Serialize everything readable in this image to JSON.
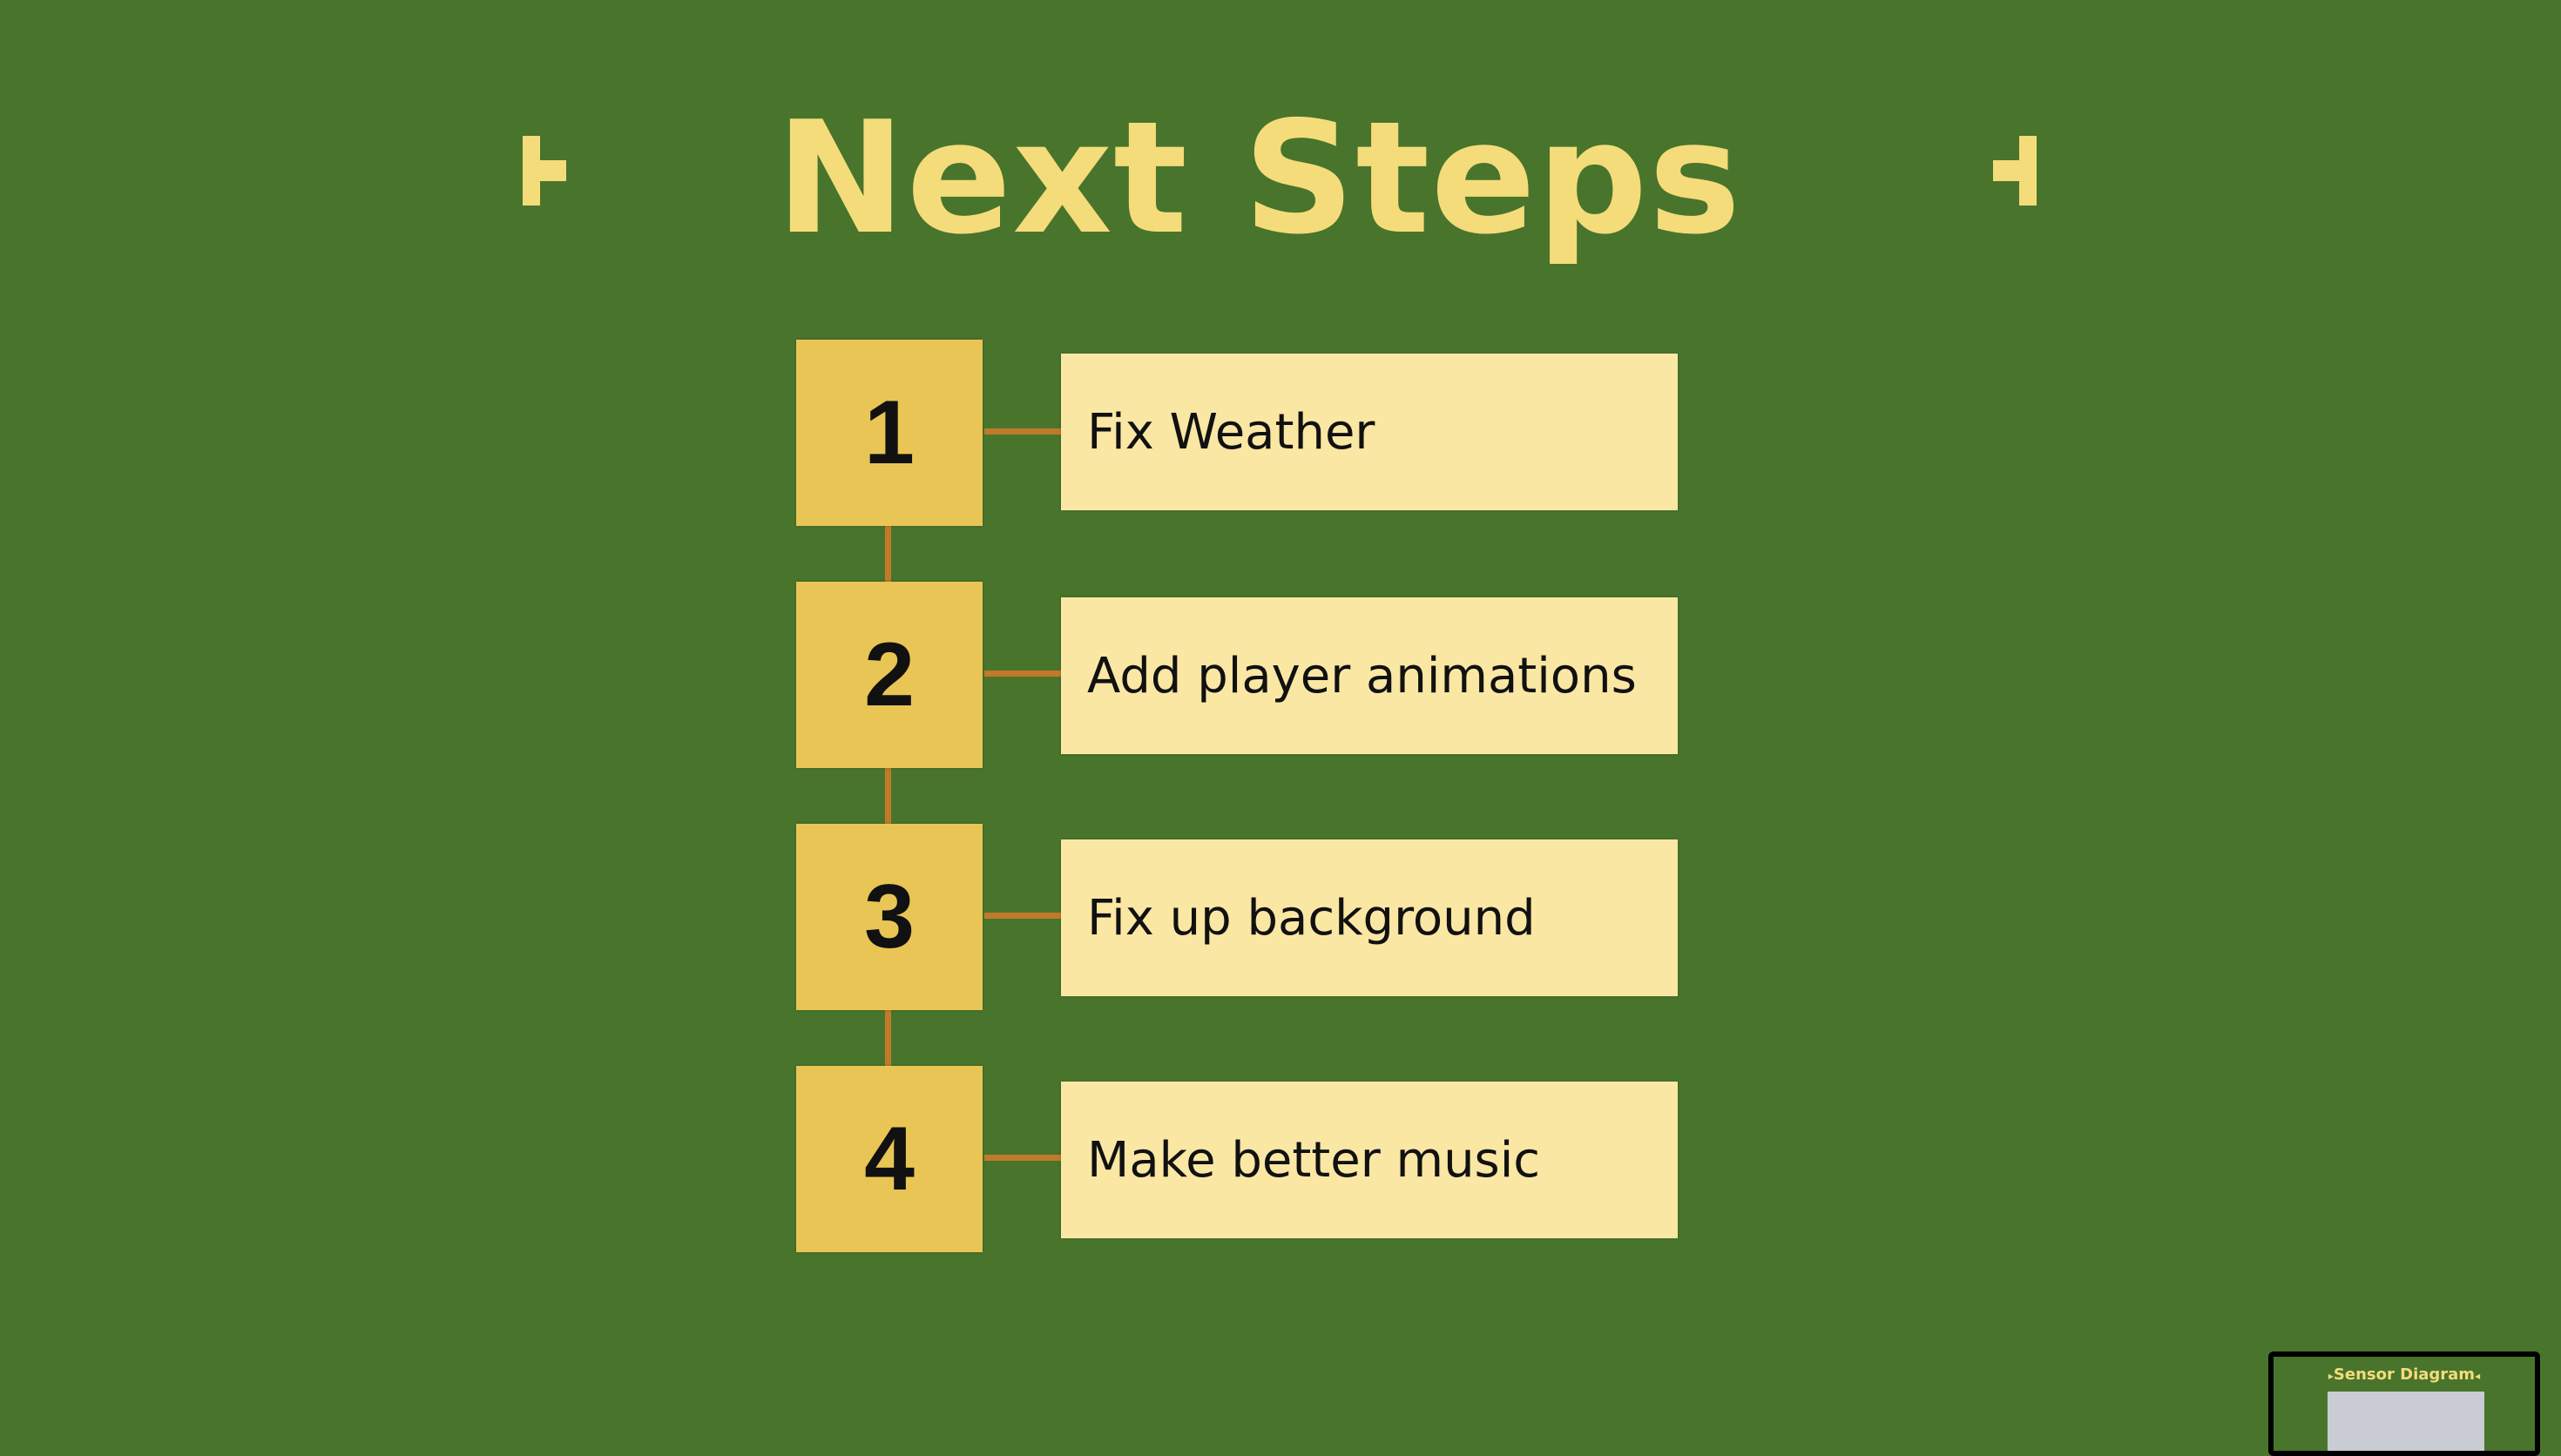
{
  "slide": {
    "title": "Next Steps",
    "steps": [
      {
        "number": "1",
        "label": "Fix Weather"
      },
      {
        "number": "2",
        "label": "Add player animations"
      },
      {
        "number": "3",
        "label": "Fix up background"
      },
      {
        "number": "4",
        "label": "Make better music"
      }
    ]
  },
  "thumbnail": {
    "title": "Sensor Diagram",
    "arrow_left": "▸",
    "arrow_right": "◂"
  },
  "colors": {
    "background": "#49742c",
    "title": "#f4dc7a",
    "number_box": "#e8c555",
    "label_box": "#fbe7a4",
    "connector": "#c07a2a"
  },
  "icons": {
    "left_decoration": "bracket-tab-icon",
    "right_decoration": "bracket-tab-icon"
  }
}
